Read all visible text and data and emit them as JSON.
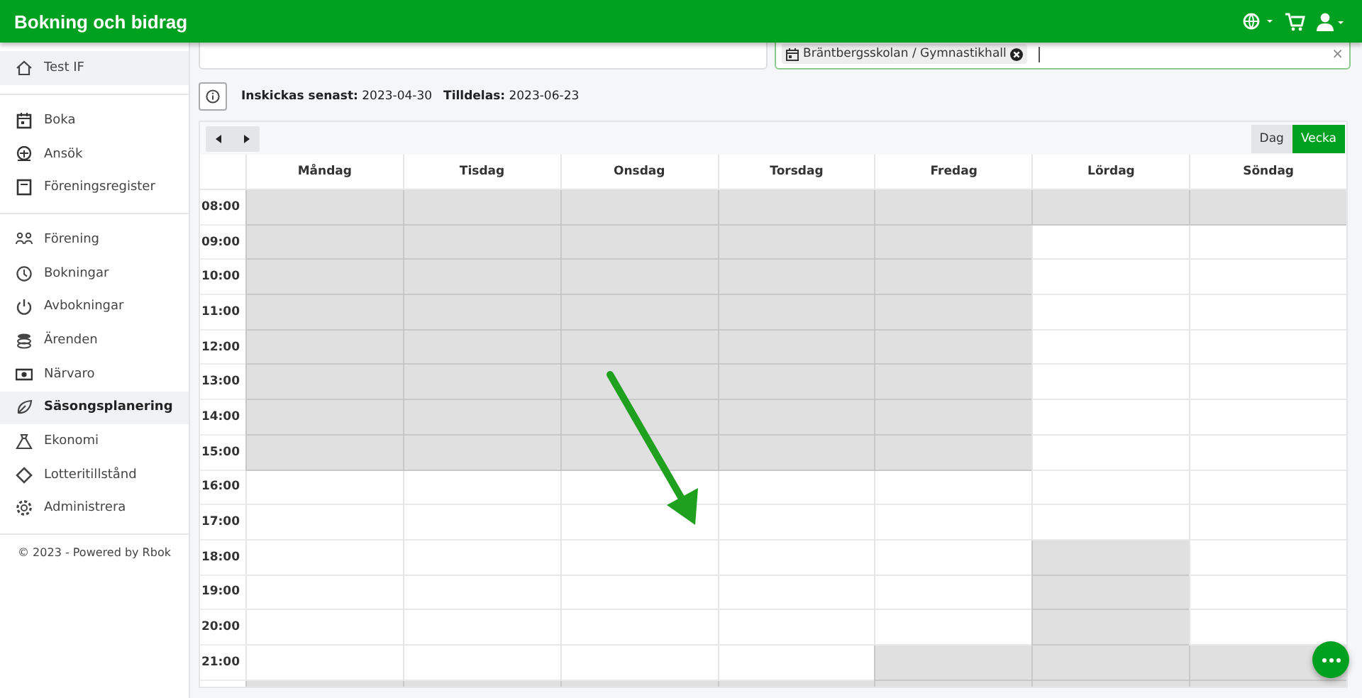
{
  "header": {
    "title": "Bokning och bidrag"
  },
  "sidebar": {
    "sections": [
      {
        "items": [
          {
            "label": "Test IF",
            "selected": true
          }
        ]
      },
      {
        "items": [
          {
            "label": "Boka",
            "selected": false
          },
          {
            "label": "Ansök",
            "selected": false
          },
          {
            "label": "Föreningsregister",
            "selected": false
          }
        ]
      },
      {
        "items": [
          {
            "label": "Förening",
            "selected": false
          },
          {
            "label": "Bokningar",
            "selected": false
          },
          {
            "label": "Avbokningar",
            "selected": false
          },
          {
            "label": "Ärenden",
            "selected": false
          },
          {
            "label": "Närvaro",
            "selected": false
          },
          {
            "label": "Säsongsplanering",
            "selected": true
          },
          {
            "label": "Ekonomi",
            "selected": false
          },
          {
            "label": "Lotteritillstånd",
            "selected": false
          },
          {
            "label": "Administrera",
            "selected": false
          }
        ]
      }
    ],
    "footer": "© 2023 - Powered by Rbok"
  },
  "facility_select": {
    "chip": "Bräntbergsskolan / Gymnastikhall",
    "clear": "×"
  },
  "info": [
    {
      "label": "Inskickas senast:",
      "value": "2023-04-30"
    },
    {
      "label": "Tilldelas:",
      "value": "2023-06-23"
    }
  ],
  "calendar": {
    "views": [
      {
        "label": "Dag",
        "selected": false
      },
      {
        "label": "Vecka",
        "selected": true
      }
    ],
    "days": [
      "Måndag",
      "Tisdag",
      "Onsdag",
      "Torsdag",
      "Fredag",
      "Lördag",
      "Söndag"
    ],
    "rows": [
      {
        "time": "08:00",
        "blocked": [
          true,
          true,
          true,
          true,
          true,
          true,
          true
        ]
      },
      {
        "time": "09:00",
        "blocked": [
          true,
          true,
          true,
          true,
          true,
          false,
          false
        ]
      },
      {
        "time": "10:00",
        "blocked": [
          true,
          true,
          true,
          true,
          true,
          false,
          false
        ]
      },
      {
        "time": "11:00",
        "blocked": [
          true,
          true,
          true,
          true,
          true,
          false,
          false
        ]
      },
      {
        "time": "12:00",
        "blocked": [
          true,
          true,
          true,
          true,
          true,
          false,
          false
        ]
      },
      {
        "time": "13:00",
        "blocked": [
          true,
          true,
          true,
          true,
          true,
          false,
          false
        ]
      },
      {
        "time": "14:00",
        "blocked": [
          true,
          true,
          true,
          true,
          true,
          false,
          false
        ]
      },
      {
        "time": "15:00",
        "blocked": [
          true,
          true,
          true,
          true,
          true,
          false,
          false
        ]
      },
      {
        "time": "16:00",
        "blocked": [
          false,
          false,
          false,
          false,
          false,
          false,
          false
        ]
      },
      {
        "time": "17:00",
        "blocked": [
          false,
          false,
          false,
          false,
          false,
          false,
          false
        ]
      },
      {
        "time": "18:00",
        "blocked": [
          false,
          false,
          false,
          false,
          false,
          true,
          false
        ]
      },
      {
        "time": "19:00",
        "blocked": [
          false,
          false,
          false,
          false,
          false,
          true,
          false
        ]
      },
      {
        "time": "20:00",
        "blocked": [
          false,
          false,
          false,
          false,
          false,
          true,
          false
        ]
      },
      {
        "time": "21:00",
        "blocked": [
          false,
          false,
          false,
          false,
          true,
          true,
          true
        ]
      },
      {
        "blocked": [
          true,
          true,
          true,
          true,
          true,
          true,
          true
        ]
      }
    ]
  }
}
